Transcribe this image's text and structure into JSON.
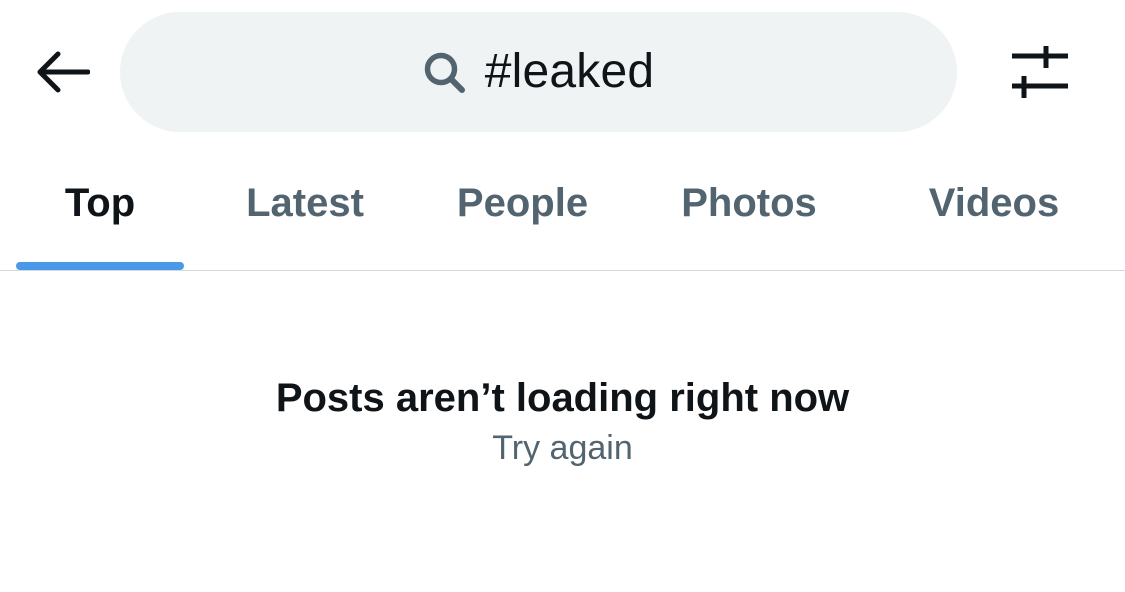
{
  "header": {
    "back_icon": "arrow-left-icon",
    "search": {
      "icon": "search-icon",
      "query": "#leaked"
    },
    "filter_icon": "sliders-icon"
  },
  "tabs": [
    {
      "label": "Top",
      "active": true
    },
    {
      "label": "Latest",
      "active": false
    },
    {
      "label": "People",
      "active": false
    },
    {
      "label": "Photos",
      "active": false
    },
    {
      "label": "Videos",
      "active": false
    }
  ],
  "message": {
    "title": "Posts aren’t loading right now",
    "action": "Try again"
  },
  "colors": {
    "accent": "#4a99e9",
    "search_bg": "#eff3f4",
    "text_primary": "#0f1419",
    "text_secondary": "#536471",
    "divider": "#cfd9de"
  }
}
